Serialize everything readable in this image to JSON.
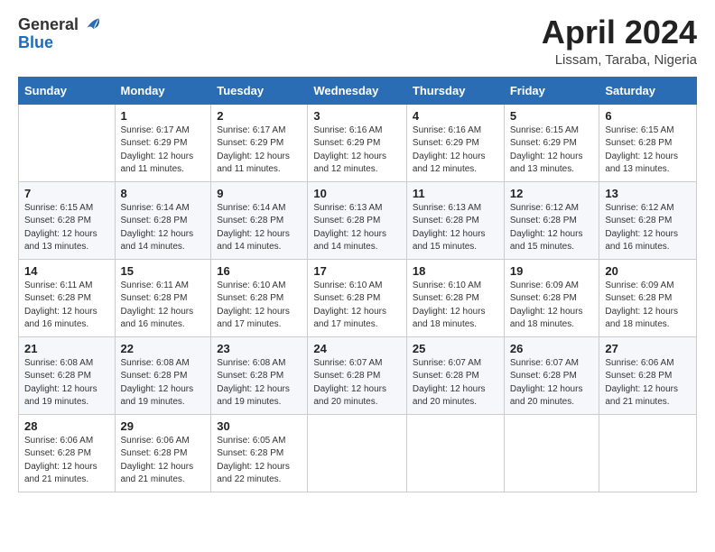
{
  "header": {
    "logo_general": "General",
    "logo_blue": "Blue",
    "title": "April 2024",
    "location": "Lissam, Taraba, Nigeria"
  },
  "calendar": {
    "days_of_week": [
      "Sunday",
      "Monday",
      "Tuesday",
      "Wednesday",
      "Thursday",
      "Friday",
      "Saturday"
    ],
    "weeks": [
      [
        {
          "num": "",
          "info": ""
        },
        {
          "num": "1",
          "info": "Sunrise: 6:17 AM\nSunset: 6:29 PM\nDaylight: 12 hours\nand 11 minutes."
        },
        {
          "num": "2",
          "info": "Sunrise: 6:17 AM\nSunset: 6:29 PM\nDaylight: 12 hours\nand 11 minutes."
        },
        {
          "num": "3",
          "info": "Sunrise: 6:16 AM\nSunset: 6:29 PM\nDaylight: 12 hours\nand 12 minutes."
        },
        {
          "num": "4",
          "info": "Sunrise: 6:16 AM\nSunset: 6:29 PM\nDaylight: 12 hours\nand 12 minutes."
        },
        {
          "num": "5",
          "info": "Sunrise: 6:15 AM\nSunset: 6:29 PM\nDaylight: 12 hours\nand 13 minutes."
        },
        {
          "num": "6",
          "info": "Sunrise: 6:15 AM\nSunset: 6:28 PM\nDaylight: 12 hours\nand 13 minutes."
        }
      ],
      [
        {
          "num": "7",
          "info": "Sunrise: 6:15 AM\nSunset: 6:28 PM\nDaylight: 12 hours\nand 13 minutes."
        },
        {
          "num": "8",
          "info": "Sunrise: 6:14 AM\nSunset: 6:28 PM\nDaylight: 12 hours\nand 14 minutes."
        },
        {
          "num": "9",
          "info": "Sunrise: 6:14 AM\nSunset: 6:28 PM\nDaylight: 12 hours\nand 14 minutes."
        },
        {
          "num": "10",
          "info": "Sunrise: 6:13 AM\nSunset: 6:28 PM\nDaylight: 12 hours\nand 14 minutes."
        },
        {
          "num": "11",
          "info": "Sunrise: 6:13 AM\nSunset: 6:28 PM\nDaylight: 12 hours\nand 15 minutes."
        },
        {
          "num": "12",
          "info": "Sunrise: 6:12 AM\nSunset: 6:28 PM\nDaylight: 12 hours\nand 15 minutes."
        },
        {
          "num": "13",
          "info": "Sunrise: 6:12 AM\nSunset: 6:28 PM\nDaylight: 12 hours\nand 16 minutes."
        }
      ],
      [
        {
          "num": "14",
          "info": "Sunrise: 6:11 AM\nSunset: 6:28 PM\nDaylight: 12 hours\nand 16 minutes."
        },
        {
          "num": "15",
          "info": "Sunrise: 6:11 AM\nSunset: 6:28 PM\nDaylight: 12 hours\nand 16 minutes."
        },
        {
          "num": "16",
          "info": "Sunrise: 6:10 AM\nSunset: 6:28 PM\nDaylight: 12 hours\nand 17 minutes."
        },
        {
          "num": "17",
          "info": "Sunrise: 6:10 AM\nSunset: 6:28 PM\nDaylight: 12 hours\nand 17 minutes."
        },
        {
          "num": "18",
          "info": "Sunrise: 6:10 AM\nSunset: 6:28 PM\nDaylight: 12 hours\nand 18 minutes."
        },
        {
          "num": "19",
          "info": "Sunrise: 6:09 AM\nSunset: 6:28 PM\nDaylight: 12 hours\nand 18 minutes."
        },
        {
          "num": "20",
          "info": "Sunrise: 6:09 AM\nSunset: 6:28 PM\nDaylight: 12 hours\nand 18 minutes."
        }
      ],
      [
        {
          "num": "21",
          "info": "Sunrise: 6:08 AM\nSunset: 6:28 PM\nDaylight: 12 hours\nand 19 minutes."
        },
        {
          "num": "22",
          "info": "Sunrise: 6:08 AM\nSunset: 6:28 PM\nDaylight: 12 hours\nand 19 minutes."
        },
        {
          "num": "23",
          "info": "Sunrise: 6:08 AM\nSunset: 6:28 PM\nDaylight: 12 hours\nand 19 minutes."
        },
        {
          "num": "24",
          "info": "Sunrise: 6:07 AM\nSunset: 6:28 PM\nDaylight: 12 hours\nand 20 minutes."
        },
        {
          "num": "25",
          "info": "Sunrise: 6:07 AM\nSunset: 6:28 PM\nDaylight: 12 hours\nand 20 minutes."
        },
        {
          "num": "26",
          "info": "Sunrise: 6:07 AM\nSunset: 6:28 PM\nDaylight: 12 hours\nand 20 minutes."
        },
        {
          "num": "27",
          "info": "Sunrise: 6:06 AM\nSunset: 6:28 PM\nDaylight: 12 hours\nand 21 minutes."
        }
      ],
      [
        {
          "num": "28",
          "info": "Sunrise: 6:06 AM\nSunset: 6:28 PM\nDaylight: 12 hours\nand 21 minutes."
        },
        {
          "num": "29",
          "info": "Sunrise: 6:06 AM\nSunset: 6:28 PM\nDaylight: 12 hours\nand 21 minutes."
        },
        {
          "num": "30",
          "info": "Sunrise: 6:05 AM\nSunset: 6:28 PM\nDaylight: 12 hours\nand 22 minutes."
        },
        {
          "num": "",
          "info": ""
        },
        {
          "num": "",
          "info": ""
        },
        {
          "num": "",
          "info": ""
        },
        {
          "num": "",
          "info": ""
        }
      ]
    ]
  }
}
